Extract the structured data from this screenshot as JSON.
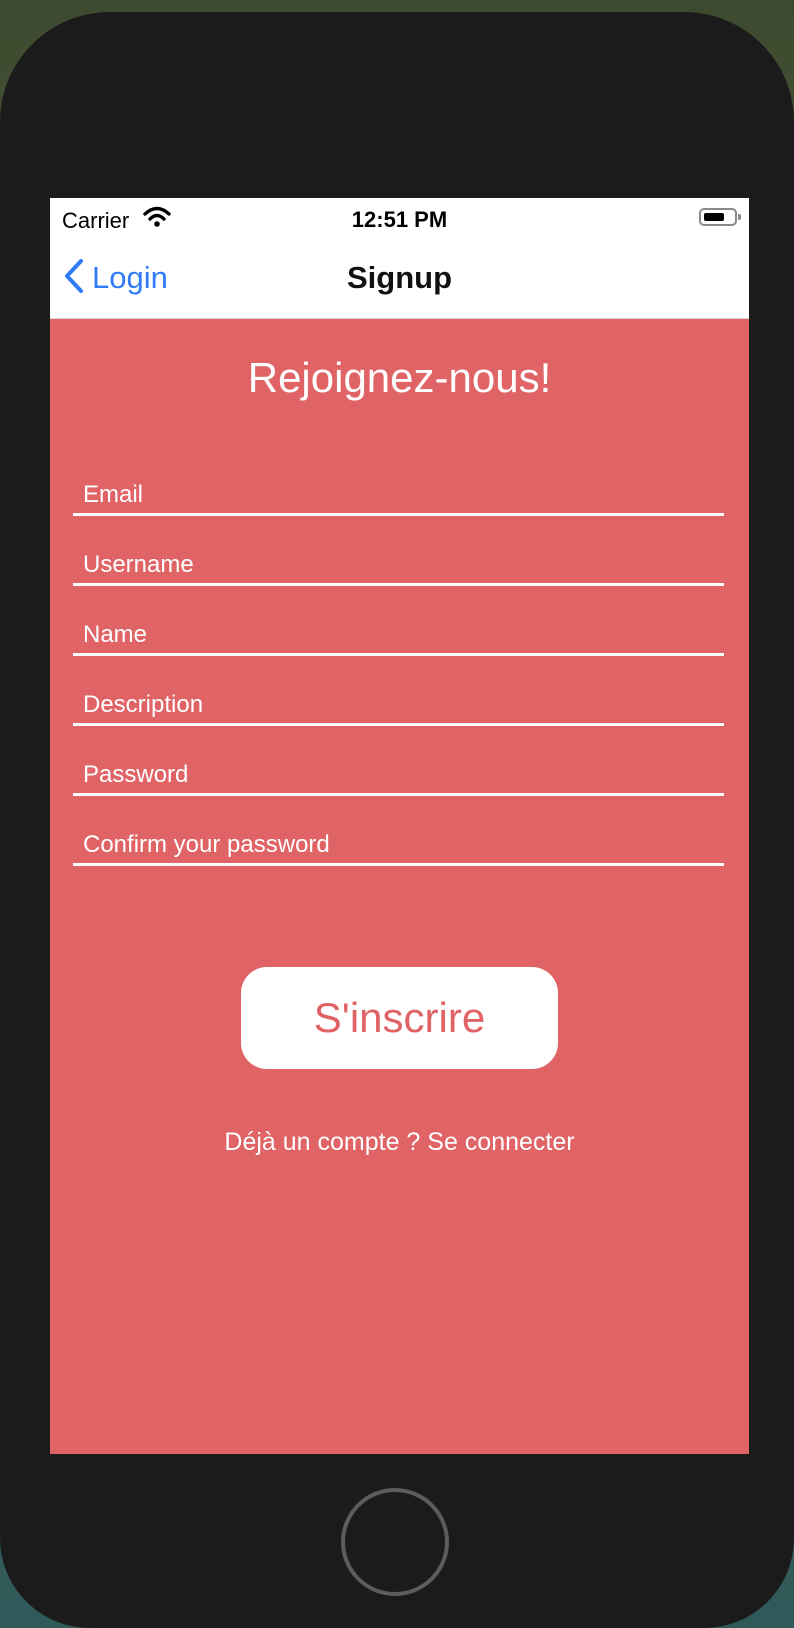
{
  "status_bar": {
    "carrier": "Carrier",
    "time": "12:51 PM",
    "wifi_icon": "wifi-icon",
    "battery_icon": "battery-icon"
  },
  "nav": {
    "back_label": "Login",
    "back_icon": "chevron-left-icon",
    "title": "Signup"
  },
  "form": {
    "heading": "Rejoignez-nous!",
    "fields": [
      {
        "placeholder": "Email",
        "value": ""
      },
      {
        "placeholder": "Username",
        "value": ""
      },
      {
        "placeholder": "Name",
        "value": ""
      },
      {
        "placeholder": "Description",
        "value": ""
      },
      {
        "placeholder": "Password",
        "value": ""
      },
      {
        "placeholder": "Confirm your password",
        "value": ""
      }
    ],
    "submit_label": "S'inscrire",
    "login_link": "Déjà un compte ? Se connecter"
  },
  "colors": {
    "background": "#e06366",
    "accent": "#2f7cf6",
    "button_bg": "#ffffff"
  }
}
